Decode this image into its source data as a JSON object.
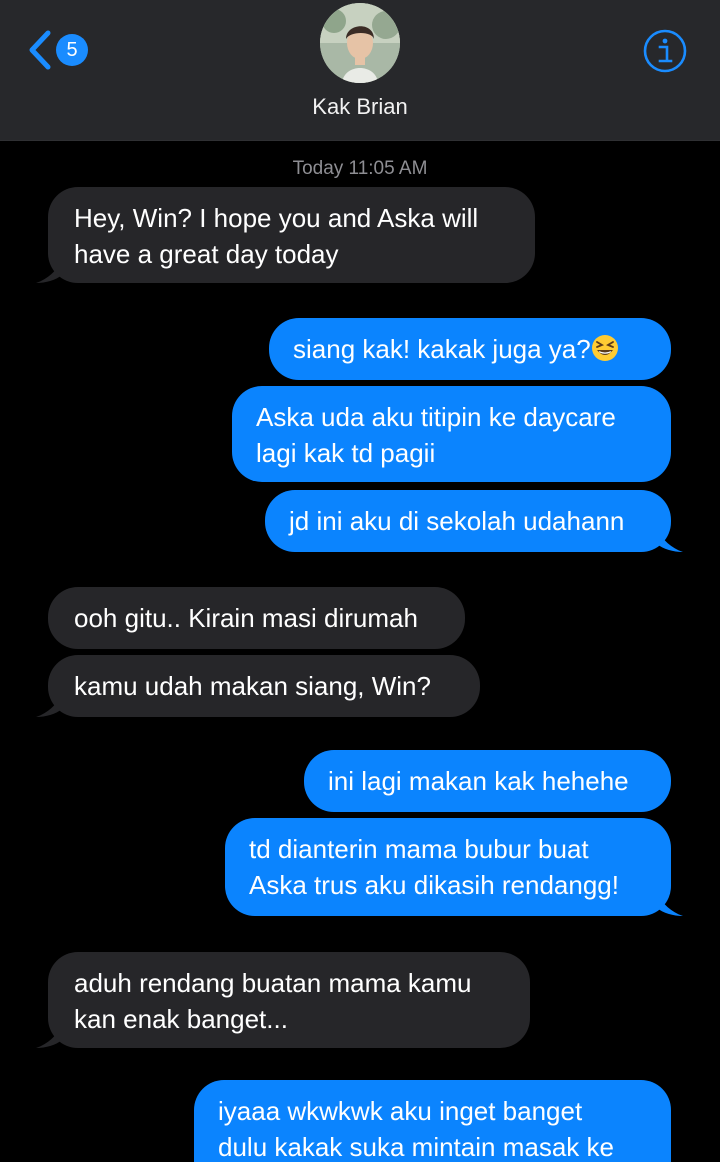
{
  "header": {
    "back_count": "5",
    "contact_name": "Kak Brian"
  },
  "conversation": {
    "timestamp": "Today 11:05 AM",
    "messages": [
      {
        "from": "contact",
        "lines": [
          "Hey, Win? I hope you and Aska will",
          "have a great day today"
        ]
      },
      {
        "from": "me",
        "lines": [
          "siang kak! kakak juga ya?"
        ],
        "emoji": "grinning-squinting-face"
      },
      {
        "from": "me",
        "lines": [
          "Aska uda aku titipin ke daycare",
          "lagi kak td pagii"
        ]
      },
      {
        "from": "me",
        "lines": [
          "jd ini aku di sekolah udahann"
        ]
      },
      {
        "from": "contact",
        "lines": [
          "ooh gitu.. Kirain masi dirumah"
        ]
      },
      {
        "from": "contact",
        "lines": [
          "kamu udah makan siang, Win?"
        ]
      },
      {
        "from": "me",
        "lines": [
          "ini lagi makan kak hehehe"
        ]
      },
      {
        "from": "me",
        "lines": [
          "td dianterin mama bubur buat",
          "Aska trus aku dikasih rendangg!"
        ]
      },
      {
        "from": "contact",
        "lines": [
          "aduh rendang buatan mama kamu",
          "kan enak banget..."
        ]
      },
      {
        "from": "me",
        "lines": [
          "iyaaa wkwkwk aku inget banget",
          "dulu kakak suka mintain masak ke"
        ]
      }
    ]
  },
  "colors": {
    "header_bg": "#27282b",
    "incoming_bubble": "#262629",
    "outgoing_bubble": "#0b84fe",
    "accent": "#1a8cff"
  },
  "icons": {
    "back": "chevron-left-icon",
    "info": "info-icon"
  }
}
